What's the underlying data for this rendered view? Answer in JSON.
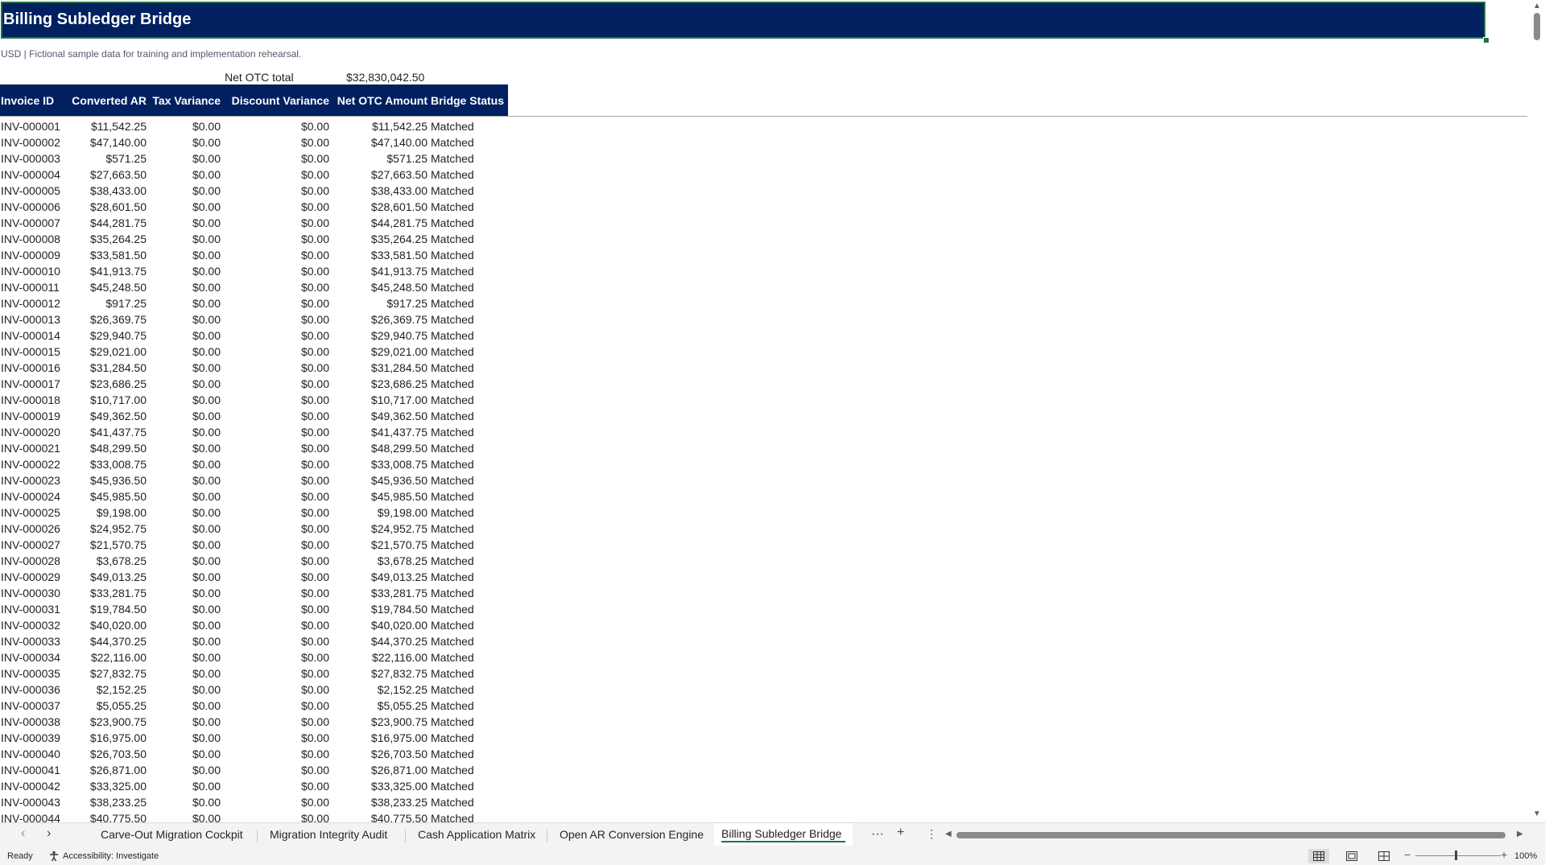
{
  "sheet": {
    "title": "Billing Subledger Bridge",
    "subtitle": "USD | Fictional sample data for training and implementation rehearsal.",
    "net_total_label": "Net OTC total",
    "net_total_value": "$32,830,042.50"
  },
  "table": {
    "headers": [
      "Invoice ID",
      "Converted AR",
      "Tax Variance",
      "Discount Variance",
      "Net OTC Amount",
      "Bridge Status"
    ],
    "rows": [
      [
        "INV-000001",
        "$11,542.25",
        "$0.00",
        "$0.00",
        "$11,542.25",
        "Matched"
      ],
      [
        "INV-000002",
        "$47,140.00",
        "$0.00",
        "$0.00",
        "$47,140.00",
        "Matched"
      ],
      [
        "INV-000003",
        "$571.25",
        "$0.00",
        "$0.00",
        "$571.25",
        "Matched"
      ],
      [
        "INV-000004",
        "$27,663.50",
        "$0.00",
        "$0.00",
        "$27,663.50",
        "Matched"
      ],
      [
        "INV-000005",
        "$38,433.00",
        "$0.00",
        "$0.00",
        "$38,433.00",
        "Matched"
      ],
      [
        "INV-000006",
        "$28,601.50",
        "$0.00",
        "$0.00",
        "$28,601.50",
        "Matched"
      ],
      [
        "INV-000007",
        "$44,281.75",
        "$0.00",
        "$0.00",
        "$44,281.75",
        "Matched"
      ],
      [
        "INV-000008",
        "$35,264.25",
        "$0.00",
        "$0.00",
        "$35,264.25",
        "Matched"
      ],
      [
        "INV-000009",
        "$33,581.50",
        "$0.00",
        "$0.00",
        "$33,581.50",
        "Matched"
      ],
      [
        "INV-000010",
        "$41,913.75",
        "$0.00",
        "$0.00",
        "$41,913.75",
        "Matched"
      ],
      [
        "INV-000011",
        "$45,248.50",
        "$0.00",
        "$0.00",
        "$45,248.50",
        "Matched"
      ],
      [
        "INV-000012",
        "$917.25",
        "$0.00",
        "$0.00",
        "$917.25",
        "Matched"
      ],
      [
        "INV-000013",
        "$26,369.75",
        "$0.00",
        "$0.00",
        "$26,369.75",
        "Matched"
      ],
      [
        "INV-000014",
        "$29,940.75",
        "$0.00",
        "$0.00",
        "$29,940.75",
        "Matched"
      ],
      [
        "INV-000015",
        "$29,021.00",
        "$0.00",
        "$0.00",
        "$29,021.00",
        "Matched"
      ],
      [
        "INV-000016",
        "$31,284.50",
        "$0.00",
        "$0.00",
        "$31,284.50",
        "Matched"
      ],
      [
        "INV-000017",
        "$23,686.25",
        "$0.00",
        "$0.00",
        "$23,686.25",
        "Matched"
      ],
      [
        "INV-000018",
        "$10,717.00",
        "$0.00",
        "$0.00",
        "$10,717.00",
        "Matched"
      ],
      [
        "INV-000019",
        "$49,362.50",
        "$0.00",
        "$0.00",
        "$49,362.50",
        "Matched"
      ],
      [
        "INV-000020",
        "$41,437.75",
        "$0.00",
        "$0.00",
        "$41,437.75",
        "Matched"
      ],
      [
        "INV-000021",
        "$48,299.50",
        "$0.00",
        "$0.00",
        "$48,299.50",
        "Matched"
      ],
      [
        "INV-000022",
        "$33,008.75",
        "$0.00",
        "$0.00",
        "$33,008.75",
        "Matched"
      ],
      [
        "INV-000023",
        "$45,936.50",
        "$0.00",
        "$0.00",
        "$45,936.50",
        "Matched"
      ],
      [
        "INV-000024",
        "$45,985.50",
        "$0.00",
        "$0.00",
        "$45,985.50",
        "Matched"
      ],
      [
        "INV-000025",
        "$9,198.00",
        "$0.00",
        "$0.00",
        "$9,198.00",
        "Matched"
      ],
      [
        "INV-000026",
        "$24,952.75",
        "$0.00",
        "$0.00",
        "$24,952.75",
        "Matched"
      ],
      [
        "INV-000027",
        "$21,570.75",
        "$0.00",
        "$0.00",
        "$21,570.75",
        "Matched"
      ],
      [
        "INV-000028",
        "$3,678.25",
        "$0.00",
        "$0.00",
        "$3,678.25",
        "Matched"
      ],
      [
        "INV-000029",
        "$49,013.25",
        "$0.00",
        "$0.00",
        "$49,013.25",
        "Matched"
      ],
      [
        "INV-000030",
        "$33,281.75",
        "$0.00",
        "$0.00",
        "$33,281.75",
        "Matched"
      ],
      [
        "INV-000031",
        "$19,784.50",
        "$0.00",
        "$0.00",
        "$19,784.50",
        "Matched"
      ],
      [
        "INV-000032",
        "$40,020.00",
        "$0.00",
        "$0.00",
        "$40,020.00",
        "Matched"
      ],
      [
        "INV-000033",
        "$44,370.25",
        "$0.00",
        "$0.00",
        "$44,370.25",
        "Matched"
      ],
      [
        "INV-000034",
        "$22,116.00",
        "$0.00",
        "$0.00",
        "$22,116.00",
        "Matched"
      ],
      [
        "INV-000035",
        "$27,832.75",
        "$0.00",
        "$0.00",
        "$27,832.75",
        "Matched"
      ],
      [
        "INV-000036",
        "$2,152.25",
        "$0.00",
        "$0.00",
        "$2,152.25",
        "Matched"
      ],
      [
        "INV-000037",
        "$5,055.25",
        "$0.00",
        "$0.00",
        "$5,055.25",
        "Matched"
      ],
      [
        "INV-000038",
        "$23,900.75",
        "$0.00",
        "$0.00",
        "$23,900.75",
        "Matched"
      ],
      [
        "INV-000039",
        "$16,975.00",
        "$0.00",
        "$0.00",
        "$16,975.00",
        "Matched"
      ],
      [
        "INV-000040",
        "$26,703.50",
        "$0.00",
        "$0.00",
        "$26,703.50",
        "Matched"
      ],
      [
        "INV-000041",
        "$26,871.00",
        "$0.00",
        "$0.00",
        "$26,871.00",
        "Matched"
      ],
      [
        "INV-000042",
        "$33,325.00",
        "$0.00",
        "$0.00",
        "$33,325.00",
        "Matched"
      ],
      [
        "INV-000043",
        "$38,233.25",
        "$0.00",
        "$0.00",
        "$38,233.25",
        "Matched"
      ],
      [
        "INV-000044",
        "$40,775.50",
        "$0.00",
        "$0.00",
        "$40,775.50",
        "Matched"
      ]
    ]
  },
  "tabs": {
    "items": [
      "Carve-Out Migration Cockpit",
      "Migration Integrity Audit",
      "Cash Application Matrix",
      "Open AR Conversion Engine"
    ],
    "active": "Billing Subledger Bridge",
    "more": "···",
    "add": "+",
    "options": "⋮"
  },
  "status_bar": {
    "ready": "Ready",
    "accessibility": "Accessibility: Investigate",
    "zoom": "100%"
  },
  "colors": {
    "header_fill": "#002060",
    "selection_border": "#217346"
  }
}
